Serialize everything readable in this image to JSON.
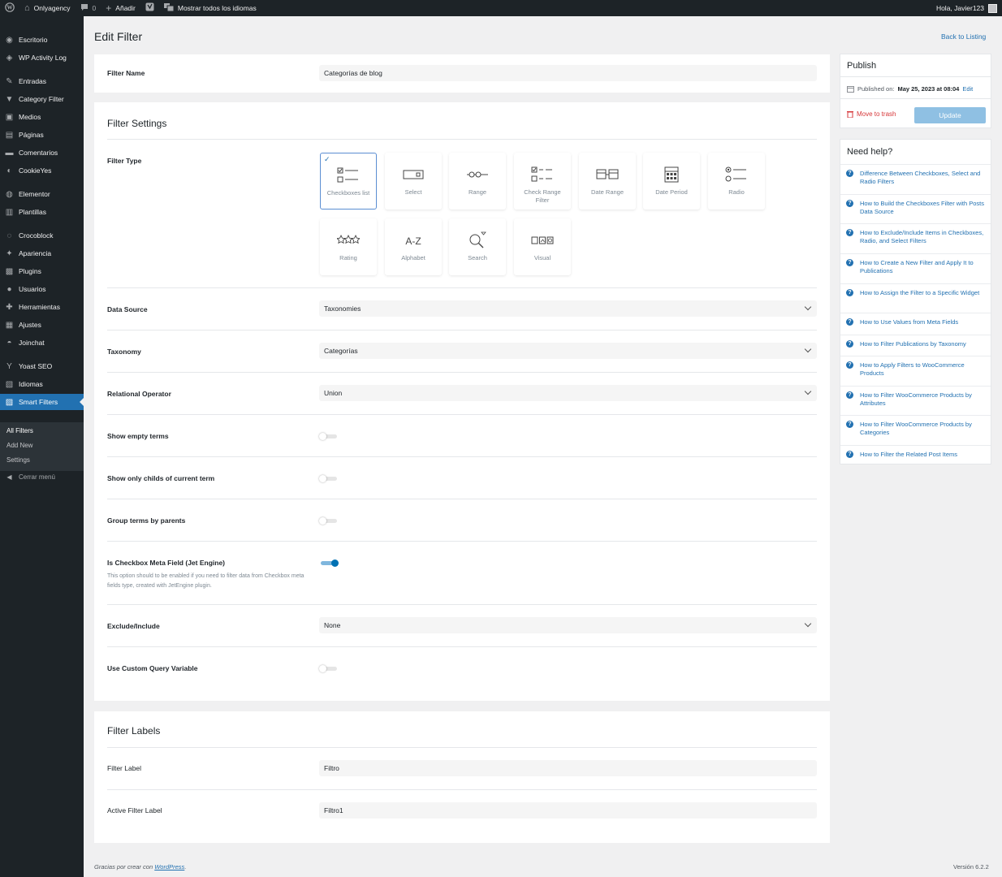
{
  "admin_bar": {
    "site_name": "Onlyagency",
    "comments_count": "0",
    "new_label": "Añadir",
    "languages_label": "Mostrar todos los idiomas",
    "greeting": "Hola, Javier123"
  },
  "sidebar": {
    "items": [
      {
        "label": "Escritorio",
        "icon": "dashboard-icon"
      },
      {
        "label": "WP Activity Log",
        "icon": "activity-log-icon"
      },
      {
        "label": "Entradas",
        "icon": "pin-icon"
      },
      {
        "label": "Category Filter",
        "icon": "filter-icon"
      },
      {
        "label": "Medios",
        "icon": "media-icon"
      },
      {
        "label": "Páginas",
        "icon": "pages-icon"
      },
      {
        "label": "Comentarios",
        "icon": "comments-icon"
      },
      {
        "label": "CookieYes",
        "icon": "cookie-icon"
      },
      {
        "label": "Elementor",
        "icon": "elementor-icon"
      },
      {
        "label": "Plantillas",
        "icon": "templates-icon"
      },
      {
        "label": "Crocoblock",
        "icon": "crocoblock-icon"
      },
      {
        "label": "Apariencia",
        "icon": "appearance-icon"
      },
      {
        "label": "Plugins",
        "icon": "plugins-icon"
      },
      {
        "label": "Usuarios",
        "icon": "users-icon"
      },
      {
        "label": "Herramientas",
        "icon": "tools-icon"
      },
      {
        "label": "Ajustes",
        "icon": "settings-icon"
      },
      {
        "label": "Joinchat",
        "icon": "chat-icon"
      },
      {
        "label": "Yoast SEO",
        "icon": "yoast-icon"
      },
      {
        "label": "Idiomas",
        "icon": "languages-icon"
      },
      {
        "label": "Smart Filters",
        "icon": "smart-filters-icon"
      }
    ],
    "submenu": [
      "All Filters",
      "Add New",
      "Settings"
    ],
    "collapse_label": "Cerrar menú"
  },
  "page": {
    "title": "Edit Filter",
    "back_link": "Back to Listing"
  },
  "filter_name": {
    "label": "Filter Name",
    "value": "Categorías de blog"
  },
  "settings": {
    "title": "Filter Settings",
    "filter_type_label": "Filter Type",
    "filter_types": [
      {
        "label": "Checkboxes list",
        "icon": "checkboxes-icon",
        "selected": true
      },
      {
        "label": "Select",
        "icon": "select-icon",
        "selected": false
      },
      {
        "label": "Range",
        "icon": "range-icon",
        "selected": false
      },
      {
        "label": "Check Range Filter",
        "icon": "check-range-icon",
        "selected": false
      },
      {
        "label": "Date Range",
        "icon": "date-range-icon",
        "selected": false
      },
      {
        "label": "Date Period",
        "icon": "calendar-icon",
        "selected": false
      },
      {
        "label": "Radio",
        "icon": "radio-icon",
        "selected": false
      },
      {
        "label": "Rating",
        "icon": "rating-icon",
        "selected": false
      },
      {
        "label": "Alphabet",
        "icon": "alphabet-icon",
        "selected": false
      },
      {
        "label": "Search",
        "icon": "search-icon",
        "selected": false
      },
      {
        "label": "Visual",
        "icon": "visual-icon",
        "selected": false
      }
    ],
    "data_source": {
      "label": "Data Source",
      "value": "Taxonomies"
    },
    "taxonomy": {
      "label": "Taxonomy",
      "value": "Categorías"
    },
    "relational_operator": {
      "label": "Relational Operator",
      "value": "Union"
    },
    "show_empty_terms": {
      "label": "Show empty terms",
      "on": false
    },
    "show_only_childs": {
      "label": "Show only childs of current term",
      "on": false
    },
    "group_terms": {
      "label": "Group terms by parents",
      "on": false
    },
    "checkbox_meta": {
      "label": "Is Checkbox Meta Field (Jet Engine)",
      "description": "This option should to be enabled if you need to filter data from Checkbox meta fields type, created with JetEngine plugin.",
      "on": true
    },
    "exclude_include": {
      "label": "Exclude/Include",
      "value": "None"
    },
    "custom_query_var": {
      "label": "Use Custom Query Variable",
      "on": false
    }
  },
  "labels": {
    "title": "Filter Labels",
    "filter_label": {
      "label": "Filter Label",
      "value": "Filtro"
    },
    "active_filter_label": {
      "label": "Active Filter Label",
      "value": "Filtro1"
    }
  },
  "publish": {
    "title": "Publish",
    "published_on_label": "Published on:",
    "published_date": "May 25, 2023 at 08:04",
    "edit_label": "Edit",
    "trash_label": "Move to trash",
    "update_label": "Update"
  },
  "help": {
    "title": "Need help?",
    "items": [
      "Difference Between Checkboxes, Select and Radio Filters",
      "How to Build the Checkboxes Filter with Posts Data Source",
      "How to Exclude/Include Items in Checkboxes, Radio, and Select Filters",
      "How to Create a New Filter and Apply It to Publications",
      "How to Assign the Filter to a Specific Widget",
      "How to Use Values from Meta Fields",
      "How to Filter Publications by Taxonomy",
      "How to Apply Filters to WooCommerce Products",
      "How to Filter WooCommerce Products by Attributes",
      "How to Filter WooCommerce Products by Categories",
      "How to Filter the Related Post Items"
    ]
  },
  "footer": {
    "thanks_prefix": "Gracias por crear con",
    "wordpress_link": "WordPress",
    "version": "Versión 6.2.2"
  },
  "colors": {
    "admin_bar": "#1d2327",
    "accent": "#2271b1",
    "trash": "#d63638",
    "update_button": "#8fc0e3"
  }
}
